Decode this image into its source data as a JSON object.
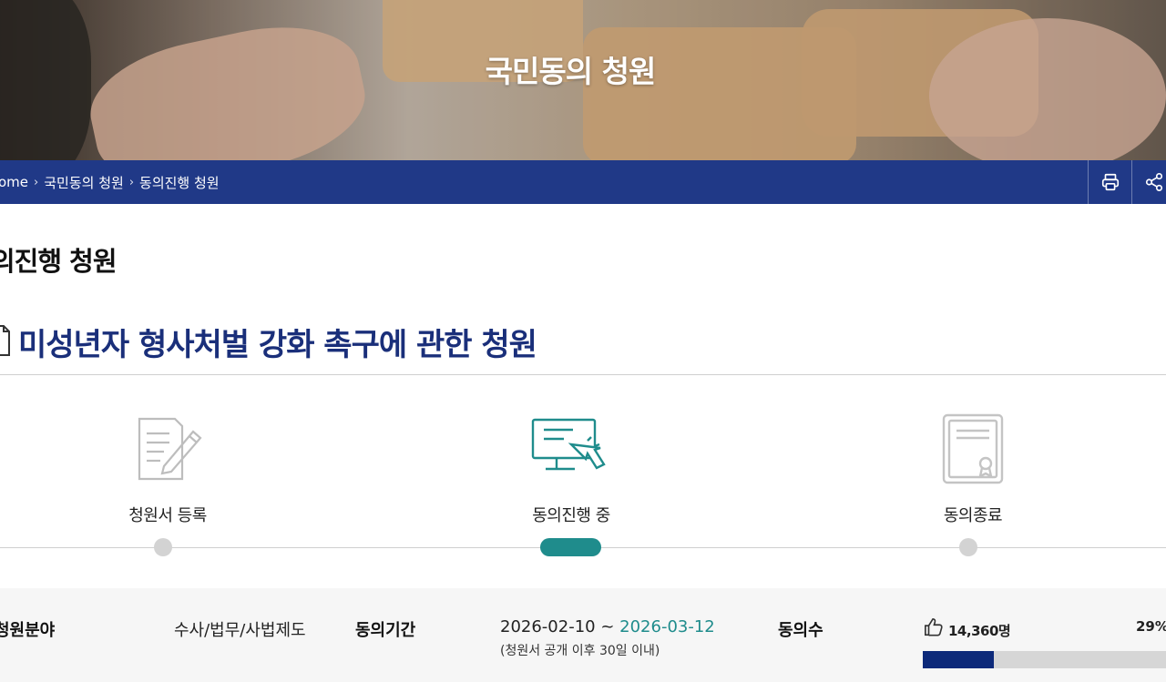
{
  "hero": {
    "title": "국민동의 청원"
  },
  "breadcrumb": {
    "items": [
      "ome",
      "국민동의 청원",
      "동의진행 청원"
    ],
    "separator": "›"
  },
  "toolbar": {
    "print_icon": "printer-icon",
    "share_icon": "share-icon"
  },
  "page": {
    "title": "의진행 청원"
  },
  "petition": {
    "title": "미성년자 형사처벌 강화 촉구에 관한 청원"
  },
  "steps": [
    {
      "label": "청원서 등록",
      "icon": "document-edit-icon",
      "state": "done"
    },
    {
      "label": "동의진행 중",
      "icon": "monitor-click-icon",
      "state": "current"
    },
    {
      "label": "동의종료",
      "icon": "certificate-icon",
      "state": "pending"
    }
  ],
  "info": {
    "field_label": "청원분야",
    "field_value": "수사/법무/사법제도",
    "period_label": "동의기간",
    "period_start": "2026-02-10 ~",
    "period_end": "2026-03-12",
    "period_note": "(청원서 공개 이후 30일 이내)",
    "agree_label": "동의수",
    "agree_count": "14,360명",
    "agree_percent_text": "29%",
    "agree_percent": 0.29
  },
  "colors": {
    "navy": "#0d2a7a",
    "teal": "#1f8c8c",
    "title_blue": "#1a2f7a"
  }
}
